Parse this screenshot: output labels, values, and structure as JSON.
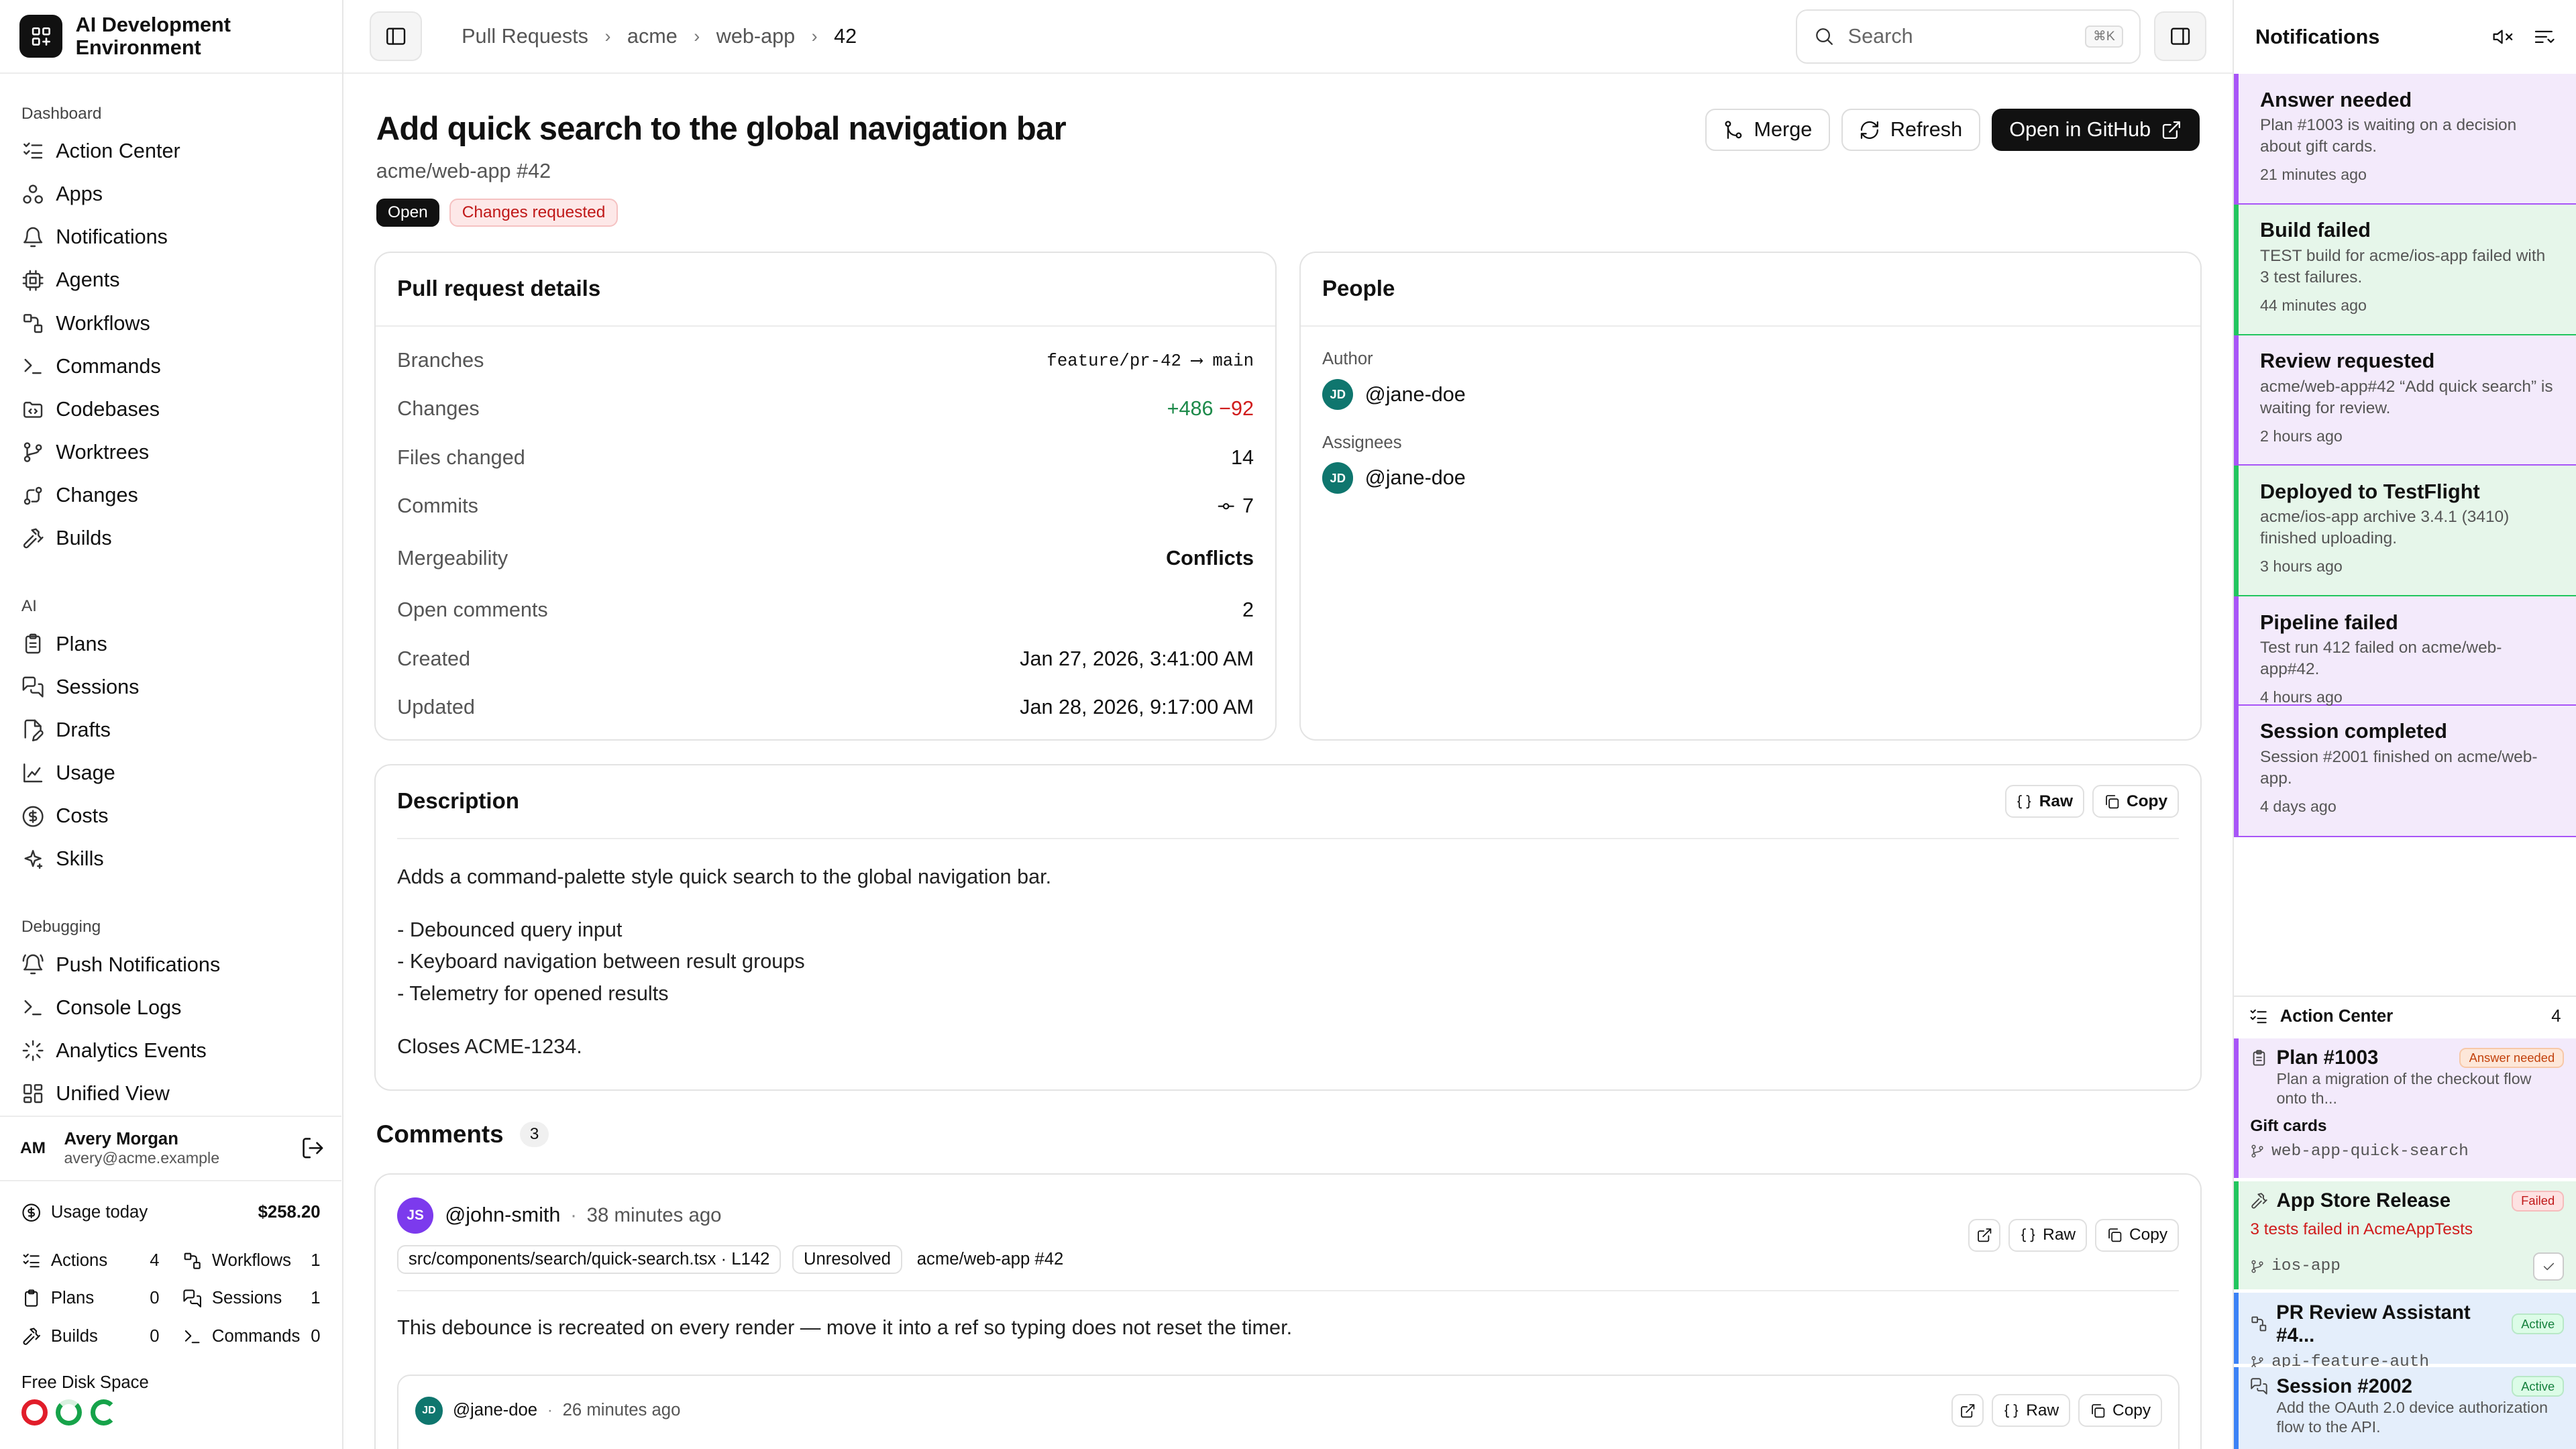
{
  "brand": {
    "title": "AI Development Environment"
  },
  "sidebar": {
    "sections": [
      {
        "label": "Dashboard",
        "items": [
          {
            "label": "Action Center",
            "icon": "list-checks-icon"
          },
          {
            "label": "Apps",
            "icon": "apps-icon"
          },
          {
            "label": "Notifications",
            "icon": "bell-icon"
          },
          {
            "label": "Agents",
            "icon": "cpu-icon"
          },
          {
            "label": "Workflows",
            "icon": "workflow-icon"
          },
          {
            "label": "Commands",
            "icon": "terminal-icon"
          },
          {
            "label": "Codebases",
            "icon": "folder-code-icon"
          },
          {
            "label": "Worktrees",
            "icon": "git-branch-icon"
          },
          {
            "label": "Changes",
            "icon": "git-compare-icon"
          },
          {
            "label": "Builds",
            "icon": "hammer-icon"
          }
        ]
      },
      {
        "label": "AI",
        "items": [
          {
            "label": "Plans",
            "icon": "clipboard-icon"
          },
          {
            "label": "Sessions",
            "icon": "messages-icon"
          },
          {
            "label": "Drafts",
            "icon": "file-edit-icon"
          },
          {
            "label": "Usage",
            "icon": "chart-icon"
          },
          {
            "label": "Costs",
            "icon": "dollar-icon"
          },
          {
            "label": "Skills",
            "icon": "sparkles-icon"
          }
        ]
      },
      {
        "label": "Debugging",
        "items": [
          {
            "label": "Push Notifications",
            "icon": "bell-ring-icon"
          },
          {
            "label": "Console Logs",
            "icon": "terminal-icon"
          },
          {
            "label": "Analytics Events",
            "icon": "activity-icon"
          },
          {
            "label": "Unified View",
            "icon": "layout-icon"
          }
        ]
      }
    ],
    "user": {
      "initials": "AM",
      "name": "Avery Morgan",
      "email": "avery@acme.example"
    },
    "usage": {
      "label": "Usage today",
      "value": "$258.20"
    },
    "stats": [
      {
        "label": "Actions",
        "value": "4"
      },
      {
        "label": "Workflows",
        "value": "1"
      },
      {
        "label": "Plans",
        "value": "0"
      },
      {
        "label": "Sessions",
        "value": "1"
      },
      {
        "label": "Builds",
        "value": "0"
      },
      {
        "label": "Commands",
        "value": "0"
      }
    ],
    "disk": {
      "label": "Free Disk Space",
      "colors": [
        "#e11d2a",
        "#16a34a",
        "#16a34a"
      ]
    }
  },
  "topbar": {
    "breadcrumbs": [
      "Pull Requests",
      "acme",
      "web-app",
      "42"
    ],
    "search_placeholder": "Search",
    "shortcut": "⌘K"
  },
  "pr": {
    "title": "Add quick search to the global navigation bar",
    "subtitle": "acme/web-app #42",
    "status": "Open",
    "review": "Changes requested",
    "buttons": {
      "merge": "Merge",
      "refresh": "Refresh",
      "github": "Open in GitHub"
    }
  },
  "details": {
    "title": "Pull request details",
    "branches_label": "Branches",
    "branch_from": "feature/pr-42",
    "branch_arrow": "⟶",
    "branch_to": "main",
    "changes_label": "Changes",
    "additions": "+486",
    "deletions": "−92",
    "files_label": "Files changed",
    "files": "14",
    "commits_label": "Commits",
    "commits": "7",
    "merge_label": "Mergeability",
    "merge": "Conflicts",
    "comments_label": "Open comments",
    "comments": "2",
    "created_label": "Created",
    "created": "Jan 27, 2026, 3:41:00 AM",
    "updated_label": "Updated",
    "updated": "Jan 28, 2026, 9:17:00 AM"
  },
  "people": {
    "title": "People",
    "author_label": "Author",
    "author": "@jane-doe",
    "author_initials": "JD",
    "assignees_label": "Assignees",
    "assignee": "@jane-doe",
    "assignee_initials": "JD"
  },
  "description": {
    "title": "Description",
    "raw": "Raw",
    "copy": "Copy",
    "intro": "Adds a command-palette style quick search to the global navigation bar.",
    "bullets": [
      "- Debounced query input",
      "- Keyboard navigation between result groups",
      "- Telemetry for opened results"
    ],
    "closes": "Closes ACME-1234."
  },
  "comments": {
    "title": "Comments",
    "count": "3",
    "first": {
      "initials": "JS",
      "author": "@john-smith",
      "dot": "·",
      "time": "38 minutes ago",
      "file": "src/components/search/quick-search.tsx · L142",
      "state": "Unresolved",
      "ref": "acme/web-app #42",
      "raw": "Raw",
      "copy": "Copy",
      "body": "This debounce is recreated on every render — move it into a ref so typing does not reset the timer."
    },
    "reply": {
      "initials": "JD",
      "author": "@jane-doe",
      "dot": "·",
      "time": "26 minutes ago",
      "raw": "Raw",
      "copy": "Copy"
    }
  },
  "notifications": {
    "title": "Notifications",
    "items": [
      {
        "title": "Answer needed",
        "body": "Plan #1003 is waiting on a decision about gift cards.",
        "time": "21 minutes ago",
        "bg": "#efe3f8",
        "border": "#a855f7"
      },
      {
        "title": "Build failed",
        "body": "TEST build for acme/ios-app failed with 3 test failures.",
        "time": "44 minutes ago",
        "bg": "#e3f5e6",
        "border": "#22c55e"
      },
      {
        "title": "Review requested",
        "body": "acme/web-app#42 “Add quick search” is waiting for review.",
        "time": "2 hours ago",
        "bg": "#efe3f8",
        "border": "#a855f7"
      },
      {
        "title": "Deployed to TestFlight",
        "body": "acme/ios-app archive 3.4.1 (3410) finished uploading.",
        "time": "3 hours ago",
        "bg": "#e3f5e6",
        "border": "#22c55e"
      },
      {
        "title": "Pipeline failed",
        "body": "Test run 412 failed on acme/web-app#42.",
        "time": "4 hours ago",
        "bg": "#efe3f8",
        "border": "#a855f7"
      },
      {
        "title": "Session completed",
        "body": "Session #2001 finished on acme/web-app.",
        "time": "4 days ago",
        "bg": "#efe3f8",
        "border": "#a855f7"
      }
    ]
  },
  "action_center": {
    "title": "Action Center",
    "count": "4",
    "items": [
      {
        "title": "Plan #1003",
        "badge": "Answer needed",
        "sub": "Plan a migration of the checkout flow onto th...",
        "extra": "Gift cards",
        "branch": "web-app-quick-search"
      },
      {
        "title": "App Store Release",
        "badge": "Failed",
        "sub": "3 tests failed in AcmeAppTests",
        "branch": "ios-app"
      },
      {
        "title": "PR Review Assistant #4...",
        "badge": "Active",
        "branch": "api-feature-auth"
      },
      {
        "title": "Session #2002",
        "badge": "Active",
        "sub": "Add the OAuth 2.0 device authorization flow to the API."
      }
    ]
  }
}
